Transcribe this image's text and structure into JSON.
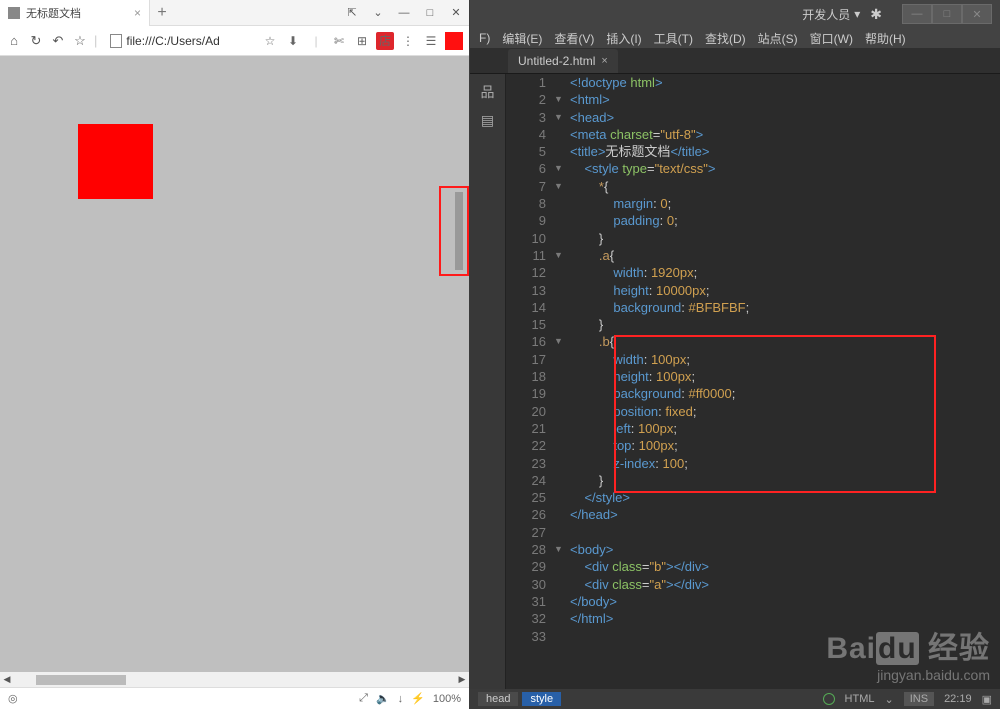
{
  "browser": {
    "tab_title": "无标题文档",
    "new_tab": "+",
    "win": {
      "pin": "⇱",
      "down": "⌄",
      "min": "—",
      "max": "□",
      "close": "✕"
    },
    "nav": {
      "home": "⌂",
      "reload": "↻",
      "back": "↶",
      "star": "☆",
      "sep": "|"
    },
    "url": "file:///C:/Users/Ad",
    "ext": {
      "scissors": "✄",
      "qr": "⊞",
      "box": "店",
      "menu": "⋮",
      "more": "☰"
    },
    "status": {
      "msg": "◎",
      "pin": "⤢",
      "audio": "🔈",
      "download": "↓",
      "speed": "⚡",
      "zoom": "100%"
    }
  },
  "editor": {
    "dev_label": "开发人员",
    "menus": [
      "F)",
      "编辑(E)",
      "查看(V)",
      "插入(I)",
      "工具(T)",
      "查找(D)",
      "站点(S)",
      "窗口(W)",
      "帮助(H)"
    ],
    "file_tab": "Untitled-2.html",
    "side": {
      "tree": "品",
      "file": "▤"
    },
    "code": {
      "lines": [
        {
          "n": 1,
          "f": "",
          "html": "<span class='tag'>&lt;!doctype</span> <span class='attr'>html</span><span class='tag'>&gt;</span>"
        },
        {
          "n": 2,
          "f": "▼",
          "html": "<span class='tag'>&lt;html&gt;</span>"
        },
        {
          "n": 3,
          "f": "▼",
          "html": "<span class='tag'>&lt;head&gt;</span>"
        },
        {
          "n": 4,
          "f": "",
          "html": "<span class='tag'>&lt;meta</span> <span class='attr'>charset</span><span class='punc'>=</span><span class='string'>\"utf-8\"</span><span class='tag'>&gt;</span>"
        },
        {
          "n": 5,
          "f": "",
          "html": "<span class='tag'>&lt;title&gt;</span><span class='text'>无标题文档</span><span class='tag'>&lt;/title&gt;</span>"
        },
        {
          "n": 6,
          "f": "▼",
          "html": "    <span class='tag'>&lt;style</span> <span class='attr'>type</span><span class='punc'>=</span><span class='string'>\"text/css\"</span><span class='tag'>&gt;</span>"
        },
        {
          "n": 7,
          "f": "▼",
          "html": "        <span class='sel'>*</span><span class='punc'>{</span>"
        },
        {
          "n": 8,
          "f": "",
          "html": "            <span class='prop'>margin</span><span class='punc'>:</span> <span class='val'>0</span><span class='punc'>;</span>"
        },
        {
          "n": 9,
          "f": "",
          "html": "            <span class='prop'>padding</span><span class='punc'>:</span> <span class='val'>0</span><span class='punc'>;</span>"
        },
        {
          "n": 10,
          "f": "",
          "html": "        <span class='punc'>}</span>"
        },
        {
          "n": 11,
          "f": "▼",
          "html": "        <span class='sel'>.a</span><span class='punc'>{</span>"
        },
        {
          "n": 12,
          "f": "",
          "html": "            <span class='prop'>width</span><span class='punc'>:</span> <span class='val'>1920px</span><span class='punc'>;</span>"
        },
        {
          "n": 13,
          "f": "",
          "html": "            <span class='prop'>height</span><span class='punc'>:</span> <span class='val'>10000px</span><span class='punc'>;</span>"
        },
        {
          "n": 14,
          "f": "",
          "html": "            <span class='prop'>background</span><span class='punc'>:</span> <span class='val'>#BFBFBF</span><span class='punc'>;</span>"
        },
        {
          "n": 15,
          "f": "",
          "html": "        <span class='punc'>}</span>"
        },
        {
          "n": 16,
          "f": "▼",
          "html": "        <span class='sel'>.b</span><span class='punc'>{</span>"
        },
        {
          "n": 17,
          "f": "",
          "html": "            <span class='prop'>width</span><span class='punc'>:</span> <span class='val'>100px</span><span class='punc'>;</span>"
        },
        {
          "n": 18,
          "f": "",
          "html": "            <span class='prop'>height</span><span class='punc'>:</span> <span class='val'>100px</span><span class='punc'>;</span>"
        },
        {
          "n": 19,
          "f": "",
          "html": "            <span class='prop'>background</span><span class='punc'>:</span> <span class='val'>#ff0000</span><span class='punc'>;</span>"
        },
        {
          "n": 20,
          "f": "",
          "html": "            <span class='prop'>position</span><span class='punc'>:</span> <span class='val'>fixed</span><span class='punc'>;</span>"
        },
        {
          "n": 21,
          "f": "",
          "html": "            <span class='prop'>left</span><span class='punc'>:</span> <span class='val'>100px</span><span class='punc'>;</span>"
        },
        {
          "n": 22,
          "f": "",
          "html": "            <span class='prop'>top</span><span class='punc'>:</span> <span class='val'>100px</span><span class='punc'>;</span>"
        },
        {
          "n": 23,
          "f": "",
          "html": "            <span class='prop'>z-index</span><span class='punc'>:</span> <span class='val'>100</span><span class='punc'>;</span>"
        },
        {
          "n": 24,
          "f": "",
          "html": "        <span class='punc'>}</span>"
        },
        {
          "n": 25,
          "f": "",
          "html": "    <span class='tag'>&lt;/style&gt;</span>"
        },
        {
          "n": 26,
          "f": "",
          "html": "<span class='tag'>&lt;/head&gt;</span>"
        },
        {
          "n": 27,
          "f": "",
          "html": ""
        },
        {
          "n": 28,
          "f": "▼",
          "html": "<span class='tag'>&lt;body&gt;</span>"
        },
        {
          "n": 29,
          "f": "",
          "html": "    <span class='tag'>&lt;div</span> <span class='attr'>class</span><span class='punc'>=</span><span class='string'>\"b\"</span><span class='tag'>&gt;&lt;/div&gt;</span>"
        },
        {
          "n": 30,
          "f": "",
          "html": "    <span class='tag'>&lt;div</span> <span class='attr'>class</span><span class='punc'>=</span><span class='string'>\"a\"</span><span class='tag'>&gt;&lt;/div&gt;</span>"
        },
        {
          "n": 31,
          "f": "",
          "html": "<span class='tag'>&lt;/body&gt;</span>"
        },
        {
          "n": 32,
          "f": "",
          "html": "<span class='tag'>&lt;/html&gt;</span>"
        },
        {
          "n": 33,
          "f": "",
          "html": ""
        }
      ]
    },
    "crumbs": [
      "head",
      "style"
    ],
    "status": {
      "lang": "HTML",
      "chev": "⌄",
      "mode": "INS",
      "pos": "22:19"
    },
    "watermark": {
      "big": "Bai",
      "du": "du",
      "jy": "经验",
      "url": "jingyan.baidu.com"
    }
  }
}
